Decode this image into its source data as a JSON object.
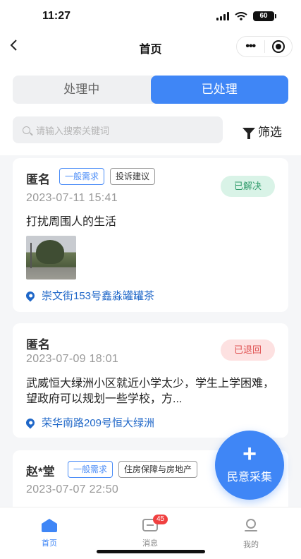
{
  "status_bar": {
    "time": "11:27",
    "battery": "60"
  },
  "nav": {
    "back_icon": "chevron-left-icon",
    "title": "首页",
    "more_icon": "more-dots-icon",
    "target_icon": "target-icon"
  },
  "segment": {
    "tabs": [
      {
        "label": "处理中",
        "active": false
      },
      {
        "label": "已处理",
        "active": true
      }
    ]
  },
  "search": {
    "placeholder": "请输入搜索关键词"
  },
  "filter": {
    "label": "筛选"
  },
  "cards": [
    {
      "name": "匿名",
      "tags": [
        "一般需求",
        "投诉建议"
      ],
      "time": "2023-07-11 15:41",
      "status": "已解决",
      "content": "打扰周围人的生活",
      "has_image": true,
      "location": "崇文街153号鑫淼罐罐茶"
    },
    {
      "name": "匿名",
      "tags": [],
      "time": "2023-07-09 18:01",
      "status": "已退回",
      "content": "武威恒大绿洲小区就近小学太少，学生上学困难，望政府可以规划一些学校，方...",
      "has_image": false,
      "location": "荣华南路209号恒大绿洲"
    },
    {
      "name": "赵*堂",
      "tags": [
        "一般需求",
        "住房保障与房地产"
      ],
      "time": "2023-07-07 22:50"
    }
  ],
  "fab": {
    "plus": "+",
    "label": "民意采集"
  },
  "tab_bar": {
    "items": [
      {
        "label": "首页",
        "icon": "home-icon",
        "active": true
      },
      {
        "label": "消息",
        "icon": "message-icon",
        "badge": "45"
      },
      {
        "label": "我的",
        "icon": "user-icon"
      }
    ]
  },
  "colors": {
    "accent": "#3f86f6",
    "resolved": "#2f9b6a",
    "returned": "#e05252",
    "link": "#1f67c8"
  }
}
